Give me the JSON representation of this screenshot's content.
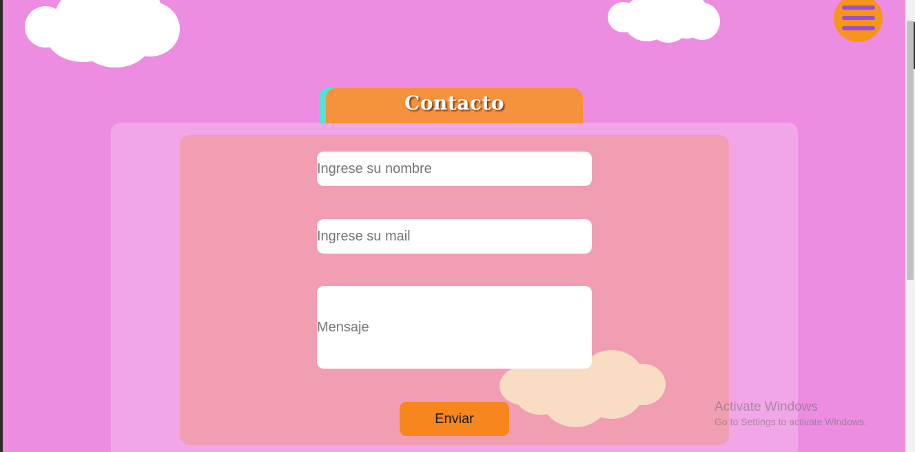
{
  "header": {
    "menu_icon": "hamburger-menu-icon"
  },
  "contact": {
    "title": "Contacto",
    "name_placeholder": "Ingrese su nombre",
    "mail_placeholder": "Ingrese su mail",
    "message_placeholder": "Mensaje",
    "send_label": "Enviar"
  },
  "watermark": {
    "line1": "Activate Windows",
    "line2": "Go to Settings to activate Windows."
  },
  "colors": {
    "background": "#ec8de2",
    "accent_orange": "#f7941d",
    "menu_lines": "#9b4fd2",
    "tab_accent": "#50e3d6",
    "form_panel": "#f29eb2"
  }
}
